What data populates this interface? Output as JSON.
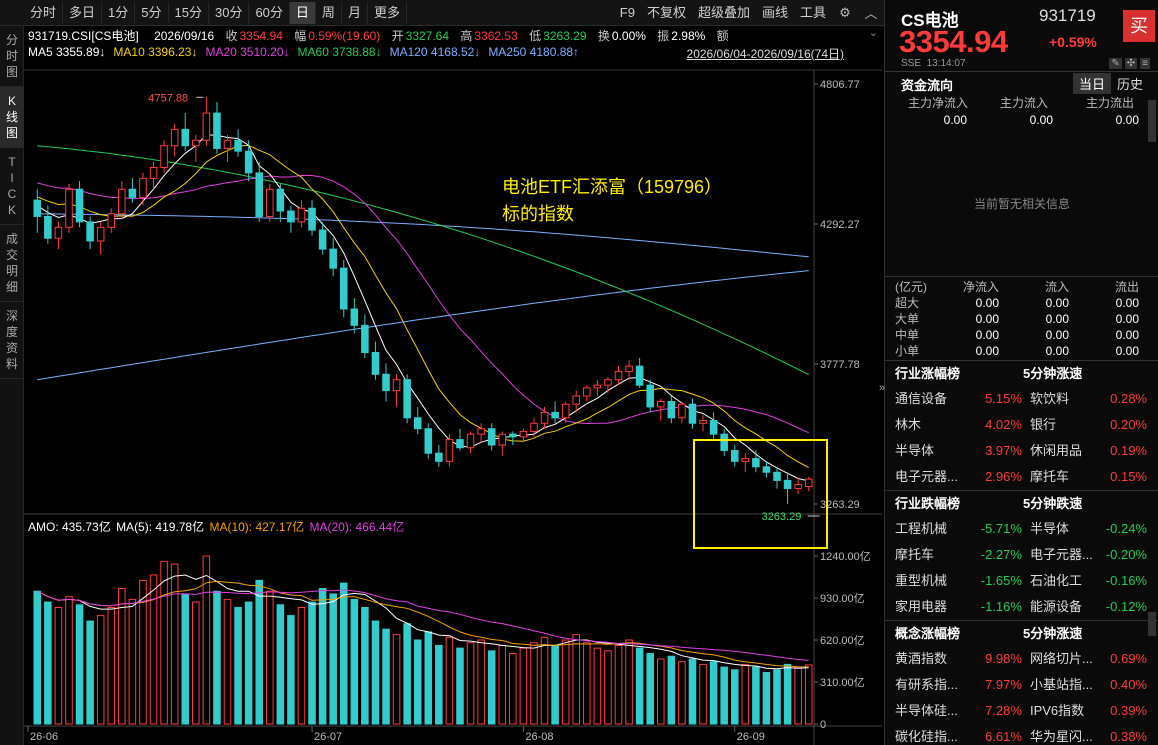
{
  "toolbar": {
    "periods": [
      "分时",
      "多日",
      "1分",
      "5分",
      "15分",
      "30分",
      "60分",
      "日",
      "周",
      "月",
      "更多"
    ],
    "active": "日",
    "right": [
      "F9",
      "不复权",
      "超级叠加",
      "画线",
      "工具"
    ]
  },
  "left_nav": [
    {
      "label": "分时图",
      "active": false
    },
    {
      "label": "K线图",
      "active": true
    },
    {
      "label": "TICK",
      "active": false
    },
    {
      "label": "成交明细",
      "active": false
    },
    {
      "label": "深度资料",
      "active": false
    }
  ],
  "header": {
    "code_name": "931719.CSI[CS电池]",
    "date": "2026/09/16",
    "close_label": "收",
    "close": "3354.94",
    "change_label": "幅",
    "change": "0.59%(19.60)",
    "open_label": "开",
    "open": "3327.64",
    "high_label": "高",
    "high": "3362.53",
    "low_label": "低",
    "low": "3263.29",
    "turnover_label": "换",
    "turnover": "0.00%",
    "amplitude_label": "振",
    "amplitude": "2.98%",
    "amount_label": "额",
    "range": "2026/06/04-2026/09/16(74日)"
  },
  "ma_line": [
    {
      "label": "MA5",
      "value": "3355.89",
      "arrow": "↓",
      "color": "#ffffff"
    },
    {
      "label": "MA10",
      "value": "3396.23",
      "arrow": "↓",
      "color": "#f5d000"
    },
    {
      "label": "MA20",
      "value": "3510.20",
      "arrow": "↓",
      "color": "#e040e0"
    },
    {
      "label": "MA60",
      "value": "3738.88",
      "arrow": "↓",
      "color": "#22cc55"
    },
    {
      "label": "MA120",
      "value": "4168.52",
      "arrow": "↓",
      "color": "#7ab0ff"
    },
    {
      "label": "MA250",
      "value": "4180.88",
      "arrow": "↑",
      "color": "#7ab0ff"
    }
  ],
  "annotation": {
    "line1": "电池ETF汇添富（159796）",
    "line2": "标的指数"
  },
  "price_axis": [
    "4806.77",
    "4292.27",
    "3777.78",
    "3263.29"
  ],
  "max_label": "4757.88",
  "min_label": "3263.29",
  "vol_header": {
    "amo": "AMO: 435.73亿",
    "ma5": "MA(5): 419.78亿",
    "ma10": "MA(10): 427.17亿",
    "ma20": "MA(20): 466.44亿"
  },
  "vol_axis": [
    "1240.00亿",
    "930.00亿",
    "620.00亿",
    "310.00亿",
    "0"
  ],
  "date_axis": [
    "26-06",
    "26-07",
    "26-08",
    "26-09"
  ],
  "colors": {
    "up": "#ff3b3b",
    "down": "#33cccc",
    "ma5": "#ffffff",
    "ma10": "#f5d000",
    "ma20": "#e040e0",
    "ma60": "#22cc55",
    "ma120": "#7ab0ff",
    "highlight": "#ffee00"
  },
  "chart_data": {
    "type": "candlestick",
    "ylim": [
      3263.29,
      4806.77
    ],
    "vol_ylim": [
      0,
      1240
    ],
    "ohlc": [
      [
        4380,
        4420,
        4260,
        4320
      ],
      [
        4320,
        4360,
        4220,
        4240
      ],
      [
        4240,
        4300,
        4200,
        4280
      ],
      [
        4280,
        4440,
        4260,
        4420
      ],
      [
        4420,
        4450,
        4280,
        4300
      ],
      [
        4300,
        4320,
        4200,
        4230
      ],
      [
        4230,
        4300,
        4180,
        4280
      ],
      [
        4280,
        4350,
        4260,
        4330
      ],
      [
        4330,
        4450,
        4310,
        4420
      ],
      [
        4420,
        4460,
        4370,
        4390
      ],
      [
        4390,
        4480,
        4360,
        4460
      ],
      [
        4460,
        4520,
        4420,
        4500
      ],
      [
        4500,
        4600,
        4480,
        4580
      ],
      [
        4580,
        4660,
        4540,
        4640
      ],
      [
        4640,
        4700,
        4560,
        4580
      ],
      [
        4580,
        4620,
        4520,
        4600
      ],
      [
        4600,
        4760,
        4580,
        4700
      ],
      [
        4700,
        4740,
        4550,
        4570
      ],
      [
        4570,
        4620,
        4520,
        4600
      ],
      [
        4600,
        4640,
        4540,
        4560
      ],
      [
        4560,
        4600,
        4450,
        4480
      ],
      [
        4480,
        4520,
        4300,
        4320
      ],
      [
        4320,
        4440,
        4300,
        4420
      ],
      [
        4420,
        4440,
        4300,
        4340
      ],
      [
        4340,
        4360,
        4260,
        4300
      ],
      [
        4300,
        4380,
        4280,
        4350
      ],
      [
        4350,
        4380,
        4250,
        4270
      ],
      [
        4270,
        4300,
        4180,
        4200
      ],
      [
        4200,
        4240,
        4100,
        4130
      ],
      [
        4130,
        4160,
        3950,
        3980
      ],
      [
        3980,
        4020,
        3890,
        3920
      ],
      [
        3920,
        3960,
        3800,
        3820
      ],
      [
        3820,
        3860,
        3720,
        3740
      ],
      [
        3740,
        3780,
        3640,
        3680
      ],
      [
        3680,
        3740,
        3620,
        3720
      ],
      [
        3720,
        3740,
        3560,
        3580
      ],
      [
        3580,
        3620,
        3520,
        3540
      ],
      [
        3540,
        3560,
        3430,
        3450
      ],
      [
        3450,
        3480,
        3400,
        3420
      ],
      [
        3420,
        3520,
        3400,
        3500
      ],
      [
        3500,
        3540,
        3460,
        3470
      ],
      [
        3470,
        3530,
        3450,
        3520
      ],
      [
        3520,
        3560,
        3490,
        3540
      ],
      [
        3540,
        3560,
        3460,
        3480
      ],
      [
        3480,
        3530,
        3440,
        3520
      ],
      [
        3520,
        3530,
        3480,
        3510
      ],
      [
        3510,
        3540,
        3490,
        3530
      ],
      [
        3530,
        3580,
        3510,
        3560
      ],
      [
        3560,
        3620,
        3540,
        3600
      ],
      [
        3600,
        3640,
        3560,
        3580
      ],
      [
        3580,
        3640,
        3560,
        3630
      ],
      [
        3630,
        3680,
        3600,
        3660
      ],
      [
        3660,
        3700,
        3640,
        3690
      ],
      [
        3690,
        3720,
        3660,
        3700
      ],
      [
        3700,
        3730,
        3670,
        3720
      ],
      [
        3720,
        3770,
        3700,
        3750
      ],
      [
        3750,
        3790,
        3720,
        3770
      ],
      [
        3770,
        3800,
        3690,
        3700
      ],
      [
        3700,
        3720,
        3600,
        3620
      ],
      [
        3620,
        3650,
        3570,
        3640
      ],
      [
        3640,
        3660,
        3560,
        3580
      ],
      [
        3580,
        3640,
        3560,
        3630
      ],
      [
        3630,
        3650,
        3540,
        3560
      ],
      [
        3560,
        3590,
        3530,
        3570
      ],
      [
        3570,
        3600,
        3500,
        3520
      ],
      [
        3520,
        3540,
        3440,
        3460
      ],
      [
        3460,
        3480,
        3400,
        3420
      ],
      [
        3420,
        3450,
        3380,
        3430
      ],
      [
        3430,
        3460,
        3380,
        3400
      ],
      [
        3400,
        3420,
        3360,
        3380
      ],
      [
        3380,
        3400,
        3320,
        3350
      ],
      [
        3350,
        3380,
        3263.29,
        3320
      ],
      [
        3320,
        3360,
        3300,
        3335
      ],
      [
        3327.64,
        3362.53,
        3310,
        3354.94
      ]
    ],
    "volume": [
      [
        980,
        "down"
      ],
      [
        900,
        "down"
      ],
      [
        860,
        "up"
      ],
      [
        940,
        "up"
      ],
      [
        880,
        "down"
      ],
      [
        760,
        "down"
      ],
      [
        800,
        "up"
      ],
      [
        860,
        "up"
      ],
      [
        1000,
        "up"
      ],
      [
        920,
        "up"
      ],
      [
        1060,
        "up"
      ],
      [
        1100,
        "up"
      ],
      [
        1200,
        "up"
      ],
      [
        1180,
        "up"
      ],
      [
        960,
        "down"
      ],
      [
        900,
        "up"
      ],
      [
        1240,
        "up"
      ],
      [
        980,
        "down"
      ],
      [
        920,
        "up"
      ],
      [
        860,
        "down"
      ],
      [
        900,
        "down"
      ],
      [
        1060,
        "down"
      ],
      [
        980,
        "up"
      ],
      [
        880,
        "down"
      ],
      [
        800,
        "down"
      ],
      [
        860,
        "up"
      ],
      [
        900,
        "down"
      ],
      [
        1000,
        "down"
      ],
      [
        960,
        "down"
      ],
      [
        1040,
        "down"
      ],
      [
        920,
        "down"
      ],
      [
        860,
        "down"
      ],
      [
        760,
        "down"
      ],
      [
        700,
        "down"
      ],
      [
        660,
        "up"
      ],
      [
        740,
        "down"
      ],
      [
        620,
        "down"
      ],
      [
        680,
        "down"
      ],
      [
        580,
        "down"
      ],
      [
        640,
        "up"
      ],
      [
        560,
        "down"
      ],
      [
        600,
        "up"
      ],
      [
        620,
        "up"
      ],
      [
        540,
        "down"
      ],
      [
        580,
        "up"
      ],
      [
        520,
        "up"
      ],
      [
        560,
        "up"
      ],
      [
        600,
        "up"
      ],
      [
        640,
        "up"
      ],
      [
        580,
        "down"
      ],
      [
        620,
        "up"
      ],
      [
        660,
        "up"
      ],
      [
        600,
        "up"
      ],
      [
        560,
        "up"
      ],
      [
        540,
        "up"
      ],
      [
        580,
        "up"
      ],
      [
        620,
        "up"
      ],
      [
        560,
        "down"
      ],
      [
        520,
        "down"
      ],
      [
        480,
        "up"
      ],
      [
        500,
        "down"
      ],
      [
        460,
        "up"
      ],
      [
        480,
        "down"
      ],
      [
        440,
        "up"
      ],
      [
        460,
        "down"
      ],
      [
        420,
        "down"
      ],
      [
        400,
        "down"
      ],
      [
        440,
        "up"
      ],
      [
        420,
        "down"
      ],
      [
        380,
        "down"
      ],
      [
        400,
        "down"
      ],
      [
        440,
        "down"
      ],
      [
        420,
        "up"
      ],
      [
        436,
        "up"
      ]
    ]
  },
  "right_panel": {
    "name": "CS电池",
    "code": "931719",
    "buy_label": "买",
    "price": "3354.94",
    "pct": "+0.59%",
    "exchange": "SSE",
    "time": "13:14:07",
    "fund_title": "资金流向",
    "tabs": [
      "当日",
      "历史"
    ],
    "fund_cols": [
      "主力净流入",
      "主力流入",
      "主力流出"
    ],
    "fund_vals": [
      "0.00",
      "0.00",
      "0.00"
    ],
    "no_info": "当前暂无相关信息",
    "flow_table": {
      "cols": [
        "(亿元)",
        "净流入",
        "流入",
        "流出"
      ],
      "rows": [
        [
          "超大",
          "0.00",
          "0.00",
          "0.00"
        ],
        [
          "大单",
          "0.00",
          "0.00",
          "0.00"
        ],
        [
          "中单",
          "0.00",
          "0.00",
          "0.00"
        ],
        [
          "小单",
          "0.00",
          "0.00",
          "0.00"
        ]
      ]
    },
    "boards": [
      {
        "left_title": "行业涨幅榜",
        "right_title": "5分钟涨速",
        "rows": [
          [
            "通信设备",
            "5.15%",
            "软饮料",
            "0.28%"
          ],
          [
            "林木",
            "4.02%",
            "银行",
            "0.20%"
          ],
          [
            "半导体",
            "3.97%",
            "休闲用品",
            "0.19%"
          ],
          [
            "电子元器...",
            "2.96%",
            "摩托车",
            "0.15%"
          ]
        ],
        "l_color": "red",
        "r_color": "red"
      },
      {
        "left_title": "行业跌幅榜",
        "right_title": "5分钟跌速",
        "rows": [
          [
            "工程机械",
            "-5.71%",
            "半导体",
            "-0.24%"
          ],
          [
            "摩托车",
            "-2.27%",
            "电子元器...",
            "-0.20%"
          ],
          [
            "重型机械",
            "-1.65%",
            "石油化工",
            "-0.16%"
          ],
          [
            "家用电器",
            "-1.16%",
            "能源设备",
            "-0.12%"
          ]
        ],
        "l_color": "green",
        "r_color": "green"
      },
      {
        "left_title": "概念涨幅榜",
        "right_title": "5分钟涨速",
        "rows": [
          [
            "黄酒指数",
            "9.98%",
            "网络切片...",
            "0.69%"
          ],
          [
            "有研系指...",
            "7.97%",
            "小基站指...",
            "0.40%"
          ],
          [
            "半导体硅...",
            "7.28%",
            "IPV6指数",
            "0.39%"
          ],
          [
            "碳化硅指...",
            "6.61%",
            "华为星闪...",
            "0.38%"
          ]
        ],
        "l_color": "red",
        "r_color": "red"
      }
    ]
  }
}
